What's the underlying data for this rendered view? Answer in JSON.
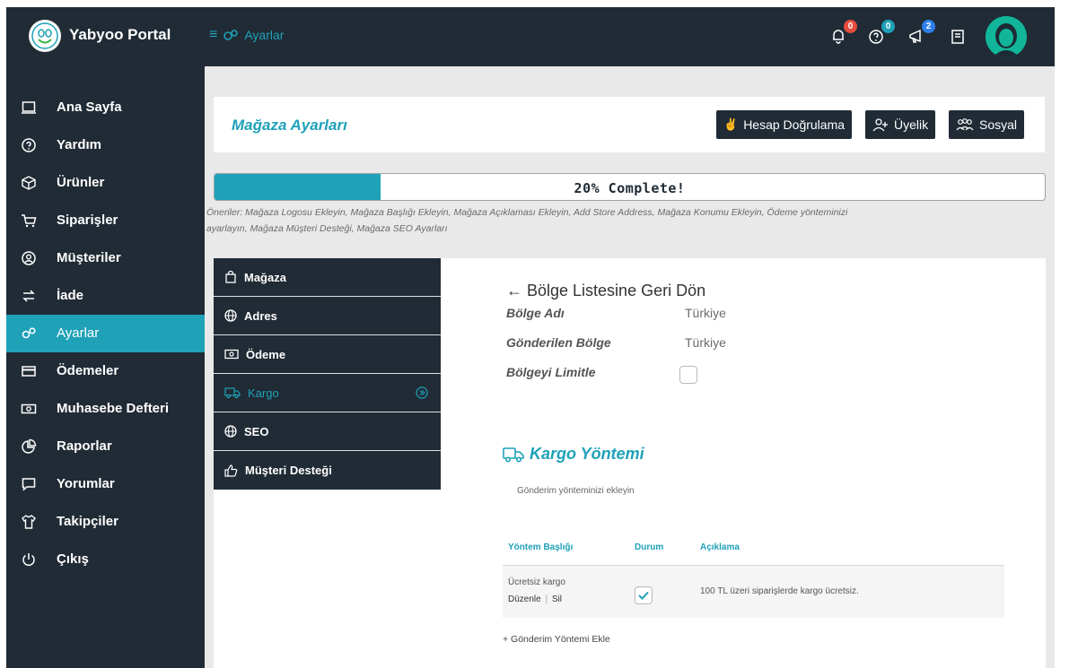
{
  "brand": {
    "name": "Yabyoo Portal",
    "logo_icon": "smiley-icon"
  },
  "topbar": {
    "breadcrumb": "Ayarlar",
    "icons": [
      {
        "name": "bell-icon",
        "badge": "0",
        "badge_color": "#e74c3c"
      },
      {
        "name": "help-icon",
        "badge": "0",
        "badge_color": "#1fa1b8"
      },
      {
        "name": "megaphone-icon",
        "badge": "2",
        "badge_color": "#2f80ed"
      },
      {
        "name": "notebook-icon"
      }
    ]
  },
  "sidebar": {
    "items": [
      {
        "label": "Ana Sayfa",
        "icon": "laptop-icon"
      },
      {
        "label": "Yardım",
        "icon": "help-icon"
      },
      {
        "label": "Ürünler",
        "icon": "box-icon"
      },
      {
        "label": "Siparişler",
        "icon": "cart-icon"
      },
      {
        "label": "Müşteriler",
        "icon": "user-circle-icon"
      },
      {
        "label": "İade",
        "icon": "return-icon"
      },
      {
        "label": "Ayarlar",
        "icon": "gears-icon",
        "active": true
      },
      {
        "label": "Ödemeler",
        "icon": "card-icon"
      },
      {
        "label": "Muhasebe Defteri",
        "icon": "money-icon"
      },
      {
        "label": "Raporlar",
        "icon": "pie-icon"
      },
      {
        "label": "Yorumlar",
        "icon": "comment-icon"
      },
      {
        "label": "Takipçiler",
        "icon": "shirt-icon"
      },
      {
        "label": "Çıkış",
        "icon": "power-icon"
      }
    ]
  },
  "header": {
    "title": "Mağaza Ayarları",
    "buttons": [
      {
        "label": "Hesap Doğrulama",
        "icon": "peace-hand-icon"
      },
      {
        "label": "Üyelik",
        "icon": "user-plus-icon"
      },
      {
        "label": "Sosyal",
        "icon": "users-icon"
      }
    ]
  },
  "progress": {
    "value": 0.2,
    "label": "20% Complete!",
    "suggestions": "Öneriler: Mağaza Logosu Ekleyin, Mağaza Başlığı Ekleyin, Mağaza Açıklaması Ekleyin, Add Store Address, Mağaza Konumu Ekleyin, Ödeme yönteminizi ayarlayın, Mağaza Müşteri Desteği, Mağaza SEO Ayarları"
  },
  "tabs": [
    {
      "label": "Mağaza",
      "icon": "bag-icon"
    },
    {
      "label": "Adres",
      "icon": "globe-icon"
    },
    {
      "label": "Ödeme",
      "icon": "money-icon"
    },
    {
      "label": "Kargo",
      "icon": "truck-icon",
      "active": true
    },
    {
      "label": "SEO",
      "icon": "globe-icon"
    },
    {
      "label": "Müşteri Desteği",
      "icon": "thumbs-up-icon"
    }
  ],
  "region": {
    "back_link": "← Bölge Listesine Geri Dön",
    "fields": [
      {
        "label": "Bölge Adı",
        "value": "Türkiye"
      },
      {
        "label": "Gönderilen Bölge",
        "value": "Türkiye"
      },
      {
        "label": "Bölgeyi Limitle",
        "checked": false
      }
    ]
  },
  "shipping": {
    "title": "Kargo Yöntemi",
    "description": "Gönderim yönteminizi ekleyin",
    "columns": [
      "Yöntem Başlığı",
      "Durum",
      "Açıklama"
    ],
    "rows": [
      {
        "title": "Ücretsiz kargo",
        "edit": "Düzenle",
        "sep": "|",
        "delete": "Sil",
        "status_checked": true,
        "description": "100 TL üzeri siparişlerde kargo ücretsiz."
      }
    ],
    "add_label": "+ Gönderim Yöntemi Ekle"
  }
}
